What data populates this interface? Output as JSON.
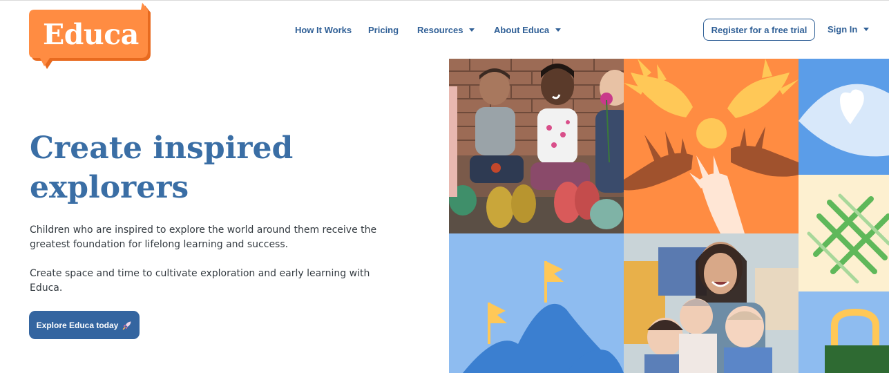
{
  "brand": {
    "logo_text": "Educa",
    "orange": "#ff8c42",
    "blue": "#2f5f96"
  },
  "nav": {
    "items": [
      {
        "label": "How It Works",
        "has_dropdown": false
      },
      {
        "label": "Pricing",
        "has_dropdown": false
      },
      {
        "label": "Resources",
        "has_dropdown": true
      },
      {
        "label": "About Educa",
        "has_dropdown": true
      }
    ],
    "register_label": "Register for a free trial",
    "signin_label": "Sign In"
  },
  "hero": {
    "headline_line1": "Create inspired",
    "headline_line2": "explorers",
    "paragraph1": "Children who are inspired to explore the world around them receive the greatest foundation for lifelong learning and success.",
    "paragraph2": "Create space and time to cultivate exploration and early learning with Educa.",
    "cta_label": "Explore Educa today",
    "cta_icon": "rocket-icon"
  },
  "mosaic": {
    "tiles": [
      {
        "name": "photo-children-sitting",
        "kind": "photo"
      },
      {
        "name": "illustration-reaching-hands",
        "kind": "illustration",
        "bg": "#ff8c42"
      },
      {
        "name": "illustration-eye-heart",
        "kind": "illustration",
        "bg": "#5b9de8"
      },
      {
        "name": "illustration-mountain-flags",
        "kind": "illustration",
        "bg": "#8ebcf0"
      },
      {
        "name": "photo-teacher-babies",
        "kind": "photo"
      },
      {
        "name": "illustration-woven-lattice",
        "kind": "illustration",
        "bg": "#fdf0d0"
      },
      {
        "name": "illustration-bag",
        "kind": "illustration",
        "bg": "#8ebcf0"
      }
    ]
  }
}
